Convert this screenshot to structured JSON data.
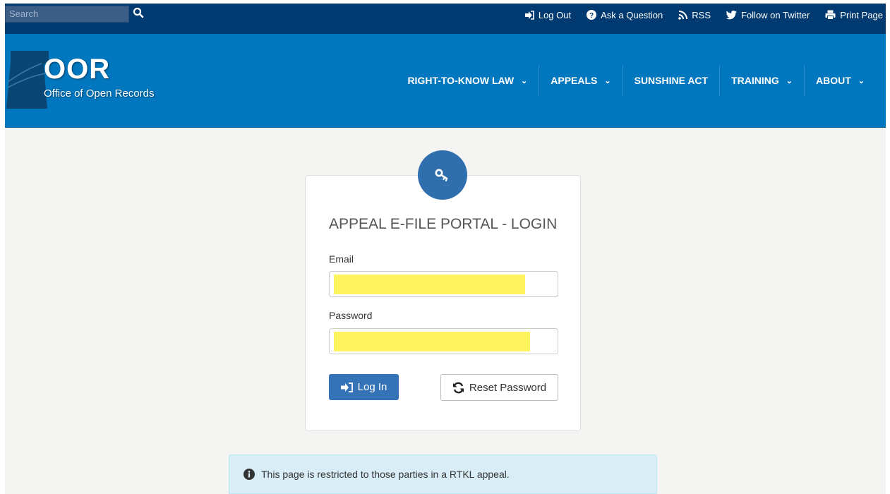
{
  "search": {
    "placeholder": "Search"
  },
  "top_links": [
    {
      "label": "Log Out",
      "icon": "sign-out-icon"
    },
    {
      "label": "Ask a Question",
      "icon": "question-circle-icon"
    },
    {
      "label": "RSS",
      "icon": "rss-icon"
    },
    {
      "label": "Follow on Twitter",
      "icon": "twitter-icon"
    },
    {
      "label": "Print Page",
      "icon": "print-icon"
    }
  ],
  "logo": {
    "title": "OOR",
    "subtitle": "Office of Open Records"
  },
  "nav": [
    {
      "label": "RIGHT-TO-KNOW LAW",
      "has_dropdown": true
    },
    {
      "label": "APPEALS",
      "has_dropdown": true
    },
    {
      "label": "SUNSHINE ACT",
      "has_dropdown": false
    },
    {
      "label": "TRAINING",
      "has_dropdown": true
    },
    {
      "label": "ABOUT",
      "has_dropdown": true
    }
  ],
  "login": {
    "title": "APPEAL E-FILE PORTAL - LOGIN",
    "email_label": "Email",
    "password_label": "Password",
    "login_button": "Log In",
    "reset_button": "Reset Password"
  },
  "info": {
    "message": "This page is restricted to those parties in a RTKL appeal."
  },
  "colors": {
    "topbar": "#003a70",
    "header": "#0077be",
    "key_circle": "#2f6fae",
    "login_button": "#3473b7",
    "info_bg": "#d9edf7",
    "redaction": "#fff45e"
  }
}
